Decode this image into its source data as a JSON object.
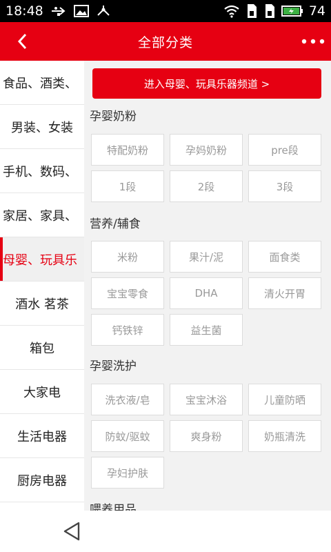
{
  "status_bar": {
    "time": "18:48",
    "battery": "74"
  },
  "header": {
    "title": "全部分类"
  },
  "sidebar": {
    "items": [
      {
        "label": "食品、酒类、"
      },
      {
        "label": "男装、女装"
      },
      {
        "label": "手机、数码、"
      },
      {
        "label": "家居、家具、"
      },
      {
        "label": "母婴、玩具乐"
      },
      {
        "label": "酒水 茗茶"
      },
      {
        "label": "箱包"
      },
      {
        "label": "大家电"
      },
      {
        "label": "生活电器"
      },
      {
        "label": "厨房电器"
      }
    ]
  },
  "content": {
    "channel_button": "进入母婴、玩具乐器频道 >",
    "sections": [
      {
        "title": "孕婴奶粉",
        "tags": [
          "特配奶粉",
          "孕妈奶粉",
          "pre段",
          "1段",
          "2段",
          "3段"
        ]
      },
      {
        "title": "营养/辅食",
        "tags": [
          "米粉",
          "果汁/泥",
          "面食类",
          "宝宝零食",
          "DHA",
          "清火开胃",
          "钙铁锌",
          "益生菌"
        ]
      },
      {
        "title": "孕婴洗护",
        "tags": [
          "洗衣液/皂",
          "宝宝沐浴",
          "儿童防晒",
          "防蚊/驱蚊",
          "爽身粉",
          "奶瓶清洗",
          "孕妇护肤"
        ]
      },
      {
        "title": "喂养用品"
      }
    ]
  },
  "colors": {
    "accent": "#e60012",
    "content_bg": "#f2f2f2",
    "tag_text": "#999999"
  }
}
